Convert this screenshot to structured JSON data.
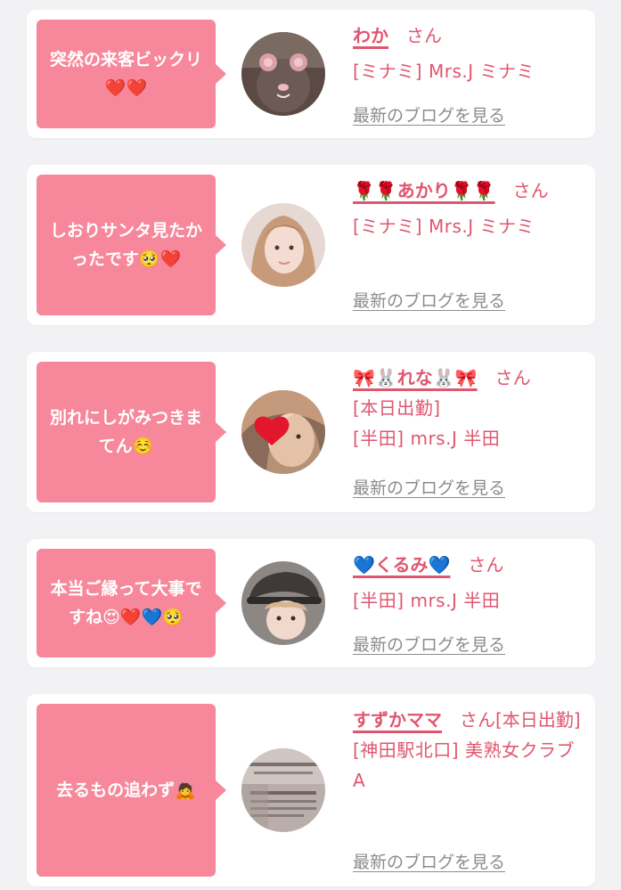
{
  "blog_link_label": "最新のブログを見る",
  "honorific": "さん",
  "cards": [
    {
      "message": "突然の来客ビックリ❤️❤️",
      "name": "わか",
      "shop": "[ミナミ] Mrs.J ミナミ",
      "status": ""
    },
    {
      "message": "しおりサンタ見たかったです🥺❤️",
      "name": "🌹🌹あかり🌹🌹",
      "shop": "[ミナミ] Mrs.J ミナミ",
      "status": ""
    },
    {
      "message": "別れにしがみつきまてん☺️",
      "name": "🎀🐰れな🐰🎀",
      "status": "[本日出勤]",
      "shop": "[半田] mrs.J 半田"
    },
    {
      "message": "本当ご縁って大事ですね😍❤️💙🥺",
      "name": "💙くるみ💙",
      "shop": "[半田] mrs.J 半田",
      "status": ""
    },
    {
      "message": "去るもの追わず🙇",
      "name": "すずかママ",
      "status": "[本日出勤]",
      "shop": "[神田駅北口] 美熟女クラブA"
    }
  ],
  "colors": {
    "accent": "#f7879a",
    "name": "#e0566e",
    "link": "#8c8c8c",
    "background": "#f2f2f4"
  }
}
